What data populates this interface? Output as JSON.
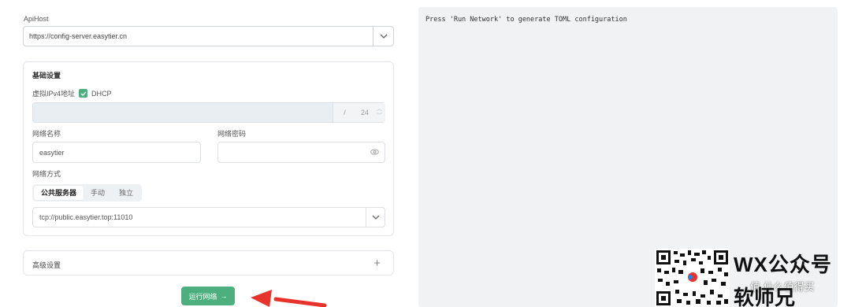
{
  "form": {
    "apihost_label": "ApiHost",
    "apihost_value": "https://config-server.easytier.cn",
    "basic_settings_title": "基础设置",
    "ipv4_label": "虚拟IPv4地址",
    "dhcp_label": "DHCP",
    "dhcp_checked": true,
    "ip_separator": "/",
    "ip_mask": "24",
    "network_name_label": "网络名称",
    "network_name_value": "easytier",
    "network_password_label": "网络密码",
    "network_mode_label": "网络方式",
    "mode_tabs": [
      {
        "label": "公共服务器",
        "active": true
      },
      {
        "label": "手动",
        "active": false
      },
      {
        "label": "独立",
        "active": false
      }
    ],
    "peer_value": "tcp://public.easytier.top:11010",
    "advanced_settings_title": "高级设置",
    "advanced_plus": "+",
    "run_button_label": "运行网络",
    "run_button_arrow": "→"
  },
  "output": {
    "placeholder": "Press 'Run Network' to generate TOML configuration"
  },
  "watermark": {
    "line1": "WX公众号",
    "line2": "软师兄",
    "small": "值 什么值得买"
  },
  "colors": {
    "accent": "#4caf7d",
    "arrow": "#e8322c",
    "output_bg": "#f1f2f3"
  }
}
